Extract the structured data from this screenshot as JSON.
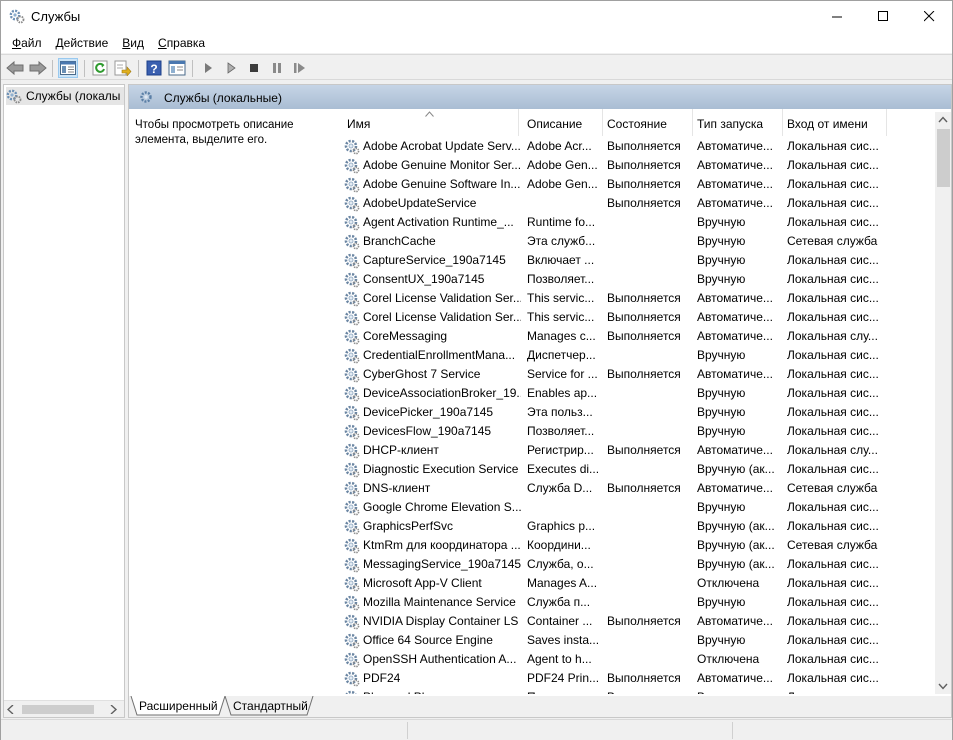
{
  "window": {
    "title": "Службы"
  },
  "menu": [
    {
      "label": "Файл"
    },
    {
      "label": "Действие"
    },
    {
      "label": "Вид"
    },
    {
      "label": "Справка"
    }
  ],
  "tree": {
    "root_label": "Службы (локалы"
  },
  "panel": {
    "header": "Службы (локальные)",
    "description": "Чтобы просмотреть описание элемента, выделите его."
  },
  "columns": [
    "Имя",
    "Описание",
    "Состояние",
    "Тип запуска",
    "Вход от имени"
  ],
  "services": [
    {
      "name": "Adobe Acrobat Update Serv...",
      "desc": "Adobe Acr...",
      "status": "Выполняется",
      "startup": "Автоматиче...",
      "logon": "Локальная сис..."
    },
    {
      "name": "Adobe Genuine Monitor Ser...",
      "desc": "Adobe Gen...",
      "status": "Выполняется",
      "startup": "Автоматиче...",
      "logon": "Локальная сис..."
    },
    {
      "name": "Adobe Genuine Software In...",
      "desc": "Adobe Gen...",
      "status": "Выполняется",
      "startup": "Автоматиче...",
      "logon": "Локальная сис..."
    },
    {
      "name": "AdobeUpdateService",
      "desc": "",
      "status": "Выполняется",
      "startup": "Автоматиче...",
      "logon": "Локальная сис..."
    },
    {
      "name": "Agent Activation Runtime_...",
      "desc": "Runtime fo...",
      "status": "",
      "startup": "Вручную",
      "logon": "Локальная сис..."
    },
    {
      "name": "BranchCache",
      "desc": "Эта служб...",
      "status": "",
      "startup": "Вручную",
      "logon": "Сетевая служба"
    },
    {
      "name": "CaptureService_190a7145",
      "desc": "Включает ...",
      "status": "",
      "startup": "Вручную",
      "logon": "Локальная сис..."
    },
    {
      "name": "ConsentUX_190a7145",
      "desc": "Позволяет...",
      "status": "",
      "startup": "Вручную",
      "logon": "Локальная сис..."
    },
    {
      "name": "Corel License Validation Ser...",
      "desc": "This servic...",
      "status": "Выполняется",
      "startup": "Автоматиче...",
      "logon": "Локальная сис..."
    },
    {
      "name": "Corel License Validation Ser...",
      "desc": "This servic...",
      "status": "Выполняется",
      "startup": "Автоматиче...",
      "logon": "Локальная сис..."
    },
    {
      "name": "CoreMessaging",
      "desc": "Manages c...",
      "status": "Выполняется",
      "startup": "Автоматиче...",
      "logon": "Локальная слу..."
    },
    {
      "name": "CredentialEnrollmentMana...",
      "desc": "Диспетчер...",
      "status": "",
      "startup": "Вручную",
      "logon": "Локальная сис..."
    },
    {
      "name": "CyberGhost 7 Service",
      "desc": "Service for ...",
      "status": "Выполняется",
      "startup": "Автоматиче...",
      "logon": "Локальная сис..."
    },
    {
      "name": "DeviceAssociationBroker_19...",
      "desc": "Enables ap...",
      "status": "",
      "startup": "Вручную",
      "logon": "Локальная сис..."
    },
    {
      "name": "DevicePicker_190a7145",
      "desc": "Эта польз...",
      "status": "",
      "startup": "Вручную",
      "logon": "Локальная сис..."
    },
    {
      "name": "DevicesFlow_190a7145",
      "desc": "Позволяет...",
      "status": "",
      "startup": "Вручную",
      "logon": "Локальная сис..."
    },
    {
      "name": "DHCP-клиент",
      "desc": "Регистрир...",
      "status": "Выполняется",
      "startup": "Автоматиче...",
      "logon": "Локальная слу..."
    },
    {
      "name": "Diagnostic Execution Service",
      "desc": "Executes di...",
      "status": "",
      "startup": "Вручную (ак...",
      "logon": "Локальная сис..."
    },
    {
      "name": "DNS-клиент",
      "desc": "Служба D...",
      "status": "Выполняется",
      "startup": "Автоматиче...",
      "logon": "Сетевая служба"
    },
    {
      "name": "Google Chrome Elevation S...",
      "desc": "",
      "status": "",
      "startup": "Вручную",
      "logon": "Локальная сис..."
    },
    {
      "name": "GraphicsPerfSvc",
      "desc": "Graphics p...",
      "status": "",
      "startup": "Вручную (ак...",
      "logon": "Локальная сис..."
    },
    {
      "name": "KtmRm для координатора ...",
      "desc": "Координи...",
      "status": "",
      "startup": "Вручную (ак...",
      "logon": "Сетевая служба"
    },
    {
      "name": "MessagingService_190a7145",
      "desc": "Служба, о...",
      "status": "",
      "startup": "Вручную (ак...",
      "logon": "Локальная сис..."
    },
    {
      "name": "Microsoft App-V Client",
      "desc": "Manages A...",
      "status": "",
      "startup": "Отключена",
      "logon": "Локальная сис..."
    },
    {
      "name": "Mozilla Maintenance Service",
      "desc": "Служба п...",
      "status": "",
      "startup": "Вручную",
      "logon": "Локальная сис..."
    },
    {
      "name": "NVIDIA Display Container LS",
      "desc": "Container ...",
      "status": "Выполняется",
      "startup": "Автоматиче...",
      "logon": "Локальная сис..."
    },
    {
      "name": "Office 64 Source Engine",
      "desc": "Saves insta...",
      "status": "",
      "startup": "Вручную",
      "logon": "Локальная сис..."
    },
    {
      "name": "OpenSSH Authentication A...",
      "desc": "Agent to h...",
      "status": "",
      "startup": "Отключена",
      "logon": "Локальная сис..."
    },
    {
      "name": "PDF24",
      "desc": "PDF24 Prin...",
      "status": "Выполняется",
      "startup": "Автоматиче...",
      "logon": "Локальная сис..."
    },
    {
      "name": "Plug and Play",
      "desc": "Позволяет...",
      "status": "Выполняется",
      "startup": "Вручную",
      "logon": "Локальная сис..."
    }
  ],
  "tabs": [
    {
      "label": "Расширенный"
    },
    {
      "label": "Стандартный"
    }
  ]
}
